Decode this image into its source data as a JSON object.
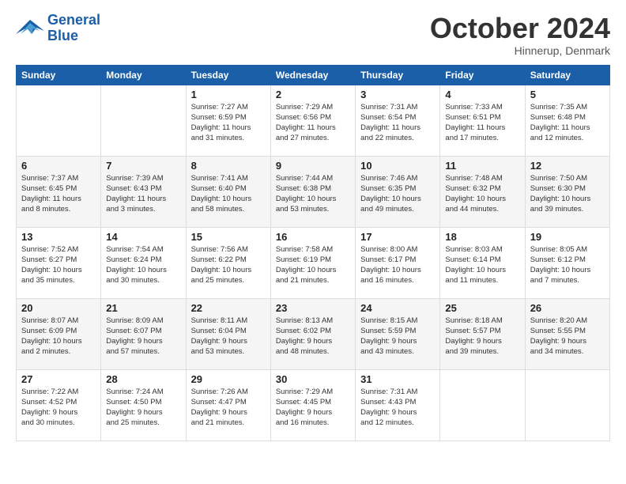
{
  "header": {
    "logo_line1": "General",
    "logo_line2": "Blue",
    "month": "October 2024",
    "location": "Hinnerup, Denmark"
  },
  "weekdays": [
    "Sunday",
    "Monday",
    "Tuesday",
    "Wednesday",
    "Thursday",
    "Friday",
    "Saturday"
  ],
  "weeks": [
    [
      {
        "day": "",
        "info": ""
      },
      {
        "day": "",
        "info": ""
      },
      {
        "day": "1",
        "info": "Sunrise: 7:27 AM\nSunset: 6:59 PM\nDaylight: 11 hours\nand 31 minutes."
      },
      {
        "day": "2",
        "info": "Sunrise: 7:29 AM\nSunset: 6:56 PM\nDaylight: 11 hours\nand 27 minutes."
      },
      {
        "day": "3",
        "info": "Sunrise: 7:31 AM\nSunset: 6:54 PM\nDaylight: 11 hours\nand 22 minutes."
      },
      {
        "day": "4",
        "info": "Sunrise: 7:33 AM\nSunset: 6:51 PM\nDaylight: 11 hours\nand 17 minutes."
      },
      {
        "day": "5",
        "info": "Sunrise: 7:35 AM\nSunset: 6:48 PM\nDaylight: 11 hours\nand 12 minutes."
      }
    ],
    [
      {
        "day": "6",
        "info": "Sunrise: 7:37 AM\nSunset: 6:45 PM\nDaylight: 11 hours\nand 8 minutes."
      },
      {
        "day": "7",
        "info": "Sunrise: 7:39 AM\nSunset: 6:43 PM\nDaylight: 11 hours\nand 3 minutes."
      },
      {
        "day": "8",
        "info": "Sunrise: 7:41 AM\nSunset: 6:40 PM\nDaylight: 10 hours\nand 58 minutes."
      },
      {
        "day": "9",
        "info": "Sunrise: 7:44 AM\nSunset: 6:38 PM\nDaylight: 10 hours\nand 53 minutes."
      },
      {
        "day": "10",
        "info": "Sunrise: 7:46 AM\nSunset: 6:35 PM\nDaylight: 10 hours\nand 49 minutes."
      },
      {
        "day": "11",
        "info": "Sunrise: 7:48 AM\nSunset: 6:32 PM\nDaylight: 10 hours\nand 44 minutes."
      },
      {
        "day": "12",
        "info": "Sunrise: 7:50 AM\nSunset: 6:30 PM\nDaylight: 10 hours\nand 39 minutes."
      }
    ],
    [
      {
        "day": "13",
        "info": "Sunrise: 7:52 AM\nSunset: 6:27 PM\nDaylight: 10 hours\nand 35 minutes."
      },
      {
        "day": "14",
        "info": "Sunrise: 7:54 AM\nSunset: 6:24 PM\nDaylight: 10 hours\nand 30 minutes."
      },
      {
        "day": "15",
        "info": "Sunrise: 7:56 AM\nSunset: 6:22 PM\nDaylight: 10 hours\nand 25 minutes."
      },
      {
        "day": "16",
        "info": "Sunrise: 7:58 AM\nSunset: 6:19 PM\nDaylight: 10 hours\nand 21 minutes."
      },
      {
        "day": "17",
        "info": "Sunrise: 8:00 AM\nSunset: 6:17 PM\nDaylight: 10 hours\nand 16 minutes."
      },
      {
        "day": "18",
        "info": "Sunrise: 8:03 AM\nSunset: 6:14 PM\nDaylight: 10 hours\nand 11 minutes."
      },
      {
        "day": "19",
        "info": "Sunrise: 8:05 AM\nSunset: 6:12 PM\nDaylight: 10 hours\nand 7 minutes."
      }
    ],
    [
      {
        "day": "20",
        "info": "Sunrise: 8:07 AM\nSunset: 6:09 PM\nDaylight: 10 hours\nand 2 minutes."
      },
      {
        "day": "21",
        "info": "Sunrise: 8:09 AM\nSunset: 6:07 PM\nDaylight: 9 hours\nand 57 minutes."
      },
      {
        "day": "22",
        "info": "Sunrise: 8:11 AM\nSunset: 6:04 PM\nDaylight: 9 hours\nand 53 minutes."
      },
      {
        "day": "23",
        "info": "Sunrise: 8:13 AM\nSunset: 6:02 PM\nDaylight: 9 hours\nand 48 minutes."
      },
      {
        "day": "24",
        "info": "Sunrise: 8:15 AM\nSunset: 5:59 PM\nDaylight: 9 hours\nand 43 minutes."
      },
      {
        "day": "25",
        "info": "Sunrise: 8:18 AM\nSunset: 5:57 PM\nDaylight: 9 hours\nand 39 minutes."
      },
      {
        "day": "26",
        "info": "Sunrise: 8:20 AM\nSunset: 5:55 PM\nDaylight: 9 hours\nand 34 minutes."
      }
    ],
    [
      {
        "day": "27",
        "info": "Sunrise: 7:22 AM\nSunset: 4:52 PM\nDaylight: 9 hours\nand 30 minutes."
      },
      {
        "day": "28",
        "info": "Sunrise: 7:24 AM\nSunset: 4:50 PM\nDaylight: 9 hours\nand 25 minutes."
      },
      {
        "day": "29",
        "info": "Sunrise: 7:26 AM\nSunset: 4:47 PM\nDaylight: 9 hours\nand 21 minutes."
      },
      {
        "day": "30",
        "info": "Sunrise: 7:29 AM\nSunset: 4:45 PM\nDaylight: 9 hours\nand 16 minutes."
      },
      {
        "day": "31",
        "info": "Sunrise: 7:31 AM\nSunset: 4:43 PM\nDaylight: 9 hours\nand 12 minutes."
      },
      {
        "day": "",
        "info": ""
      },
      {
        "day": "",
        "info": ""
      }
    ]
  ]
}
